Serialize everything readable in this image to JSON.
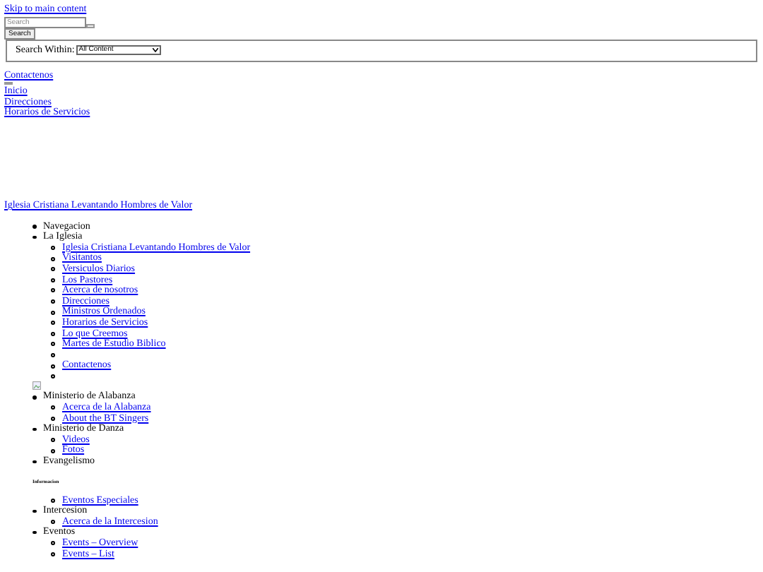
{
  "skip_link": "Skip to main content",
  "search": {
    "placeholder": "Search",
    "button": "Search",
    "within_label": "Search Within:",
    "within_value": "All Content"
  },
  "top_links": [
    "Contactenos"
  ],
  "quick_links": [
    "Inicio",
    "Direcciones",
    "Horarios de Servicios"
  ],
  "site_title": "Iglesia Cristiana Levantando Hombres de Valor",
  "nav": [
    {
      "label": "Navegacion"
    },
    {
      "label": "La Iglesia",
      "children": [
        {
          "kind": "link",
          "label": "Iglesia Cristiana Levantando Hombres de Valor"
        },
        {
          "kind": "link",
          "label": "Visitantos"
        },
        {
          "kind": "link",
          "label": "Versiculos Diarios"
        },
        {
          "kind": "link",
          "label": "Los Pastores"
        },
        {
          "kind": "link",
          "label": "Acerca de nosotros"
        },
        {
          "kind": "link",
          "label": "Direcciones"
        },
        {
          "kind": "link",
          "label": "Ministros Ordenados"
        },
        {
          "kind": "link",
          "label": "Horarios de Servicios"
        },
        {
          "kind": "link",
          "label": "Lo que Creemos"
        },
        {
          "kind": "link",
          "label": "Martes de Estudio Biblico"
        },
        {
          "kind": "empty"
        },
        {
          "kind": "link",
          "label": "Contactenos"
        },
        {
          "kind": "empty"
        }
      ],
      "after_image": true
    },
    {
      "label": "Ministerio de Alabanza",
      "children": [
        {
          "kind": "link",
          "label": "Acerca de la Alabanza"
        },
        {
          "kind": "link",
          "label": "About the BT Singers"
        }
      ]
    },
    {
      "label": "Ministerio de Danza",
      "children": [
        {
          "kind": "link",
          "label": "Videos"
        },
        {
          "kind": "link",
          "label": "Fotos"
        }
      ]
    },
    {
      "label": "Evangelismo",
      "heading": "Informacion",
      "children": [
        {
          "kind": "link",
          "label": "Eventos Especiales"
        }
      ]
    },
    {
      "label": "Intercesion",
      "children": [
        {
          "kind": "link",
          "label": "Acerca de la Intercesion"
        }
      ]
    },
    {
      "label": "Eventos",
      "children": [
        {
          "kind": "link",
          "label": "Events – Overview"
        },
        {
          "kind": "link",
          "label": "Events – List"
        }
      ]
    }
  ]
}
